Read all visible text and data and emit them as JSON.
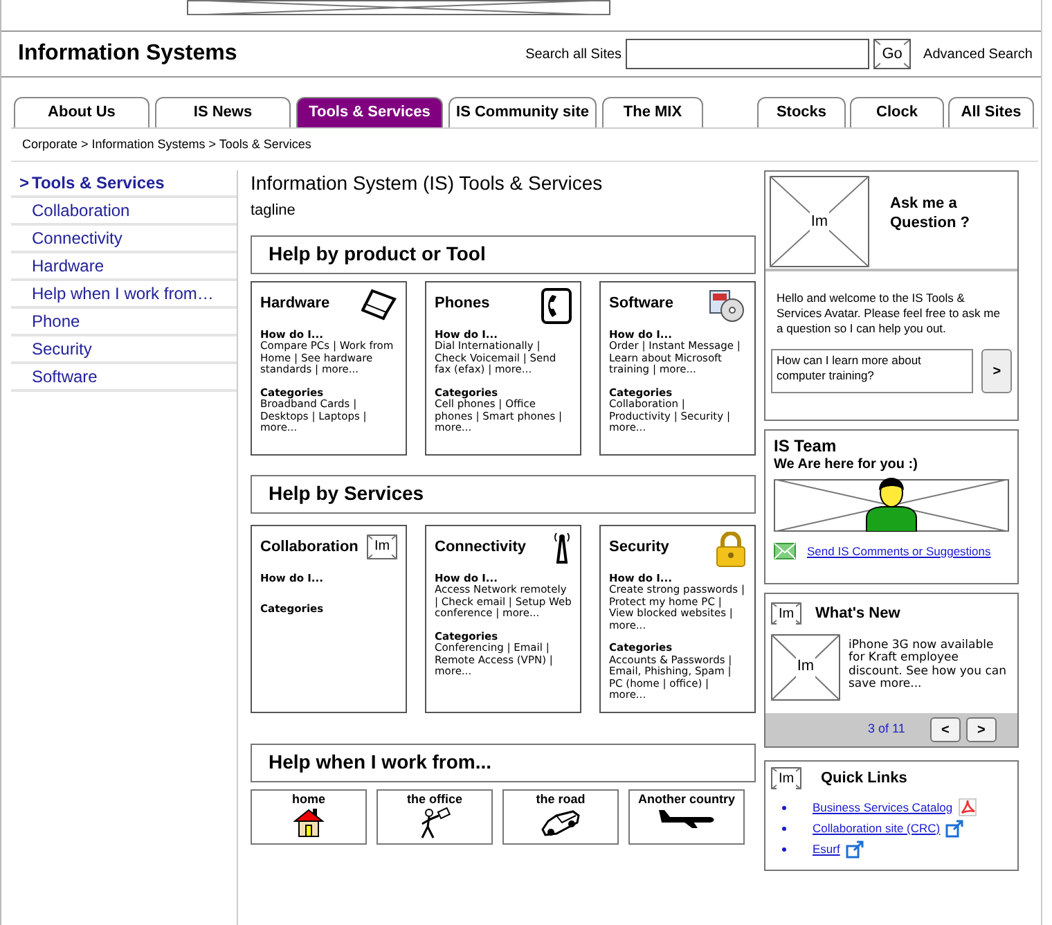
{
  "header": {
    "title": "Information Systems",
    "search_label": "Search all Sites",
    "go_button": "Go",
    "advanced_search": "Advanced Search"
  },
  "tabs_left": [
    {
      "label": "About Us",
      "selected": false
    },
    {
      "label": "IS News",
      "selected": false
    },
    {
      "label": "Tools & Services",
      "selected": true
    },
    {
      "label": "IS Community site",
      "selected": false
    },
    {
      "label": "The MIX",
      "selected": false
    }
  ],
  "tabs_right": [
    {
      "label": "Stocks",
      "selected": false
    },
    {
      "label": "Clock",
      "selected": false
    },
    {
      "label": "All Sites",
      "selected": false
    }
  ],
  "breadcrumb": "Corporate > Information Systems > Tools & Services",
  "sidebar": {
    "current_marker": ">",
    "items": [
      {
        "label": "Tools & Services",
        "selected": true
      },
      {
        "label": "Collaboration",
        "selected": false
      },
      {
        "label": "Connectivity",
        "selected": false
      },
      {
        "label": "Hardware",
        "selected": false
      },
      {
        "label": "Help when I work from…",
        "selected": false
      },
      {
        "label": "Phone",
        "selected": false
      },
      {
        "label": "Security",
        "selected": false
      },
      {
        "label": "Software",
        "selected": false
      }
    ]
  },
  "main": {
    "title": "Information System (IS) Tools & Services",
    "tagline": "tagline",
    "sections": [
      {
        "heading": "Help by product or Tool",
        "cards": [
          {
            "title": "Hardware",
            "how_heading": "How do I...",
            "how_text": "Compare PCs | Work from Home | See hardware standards | more...",
            "categories_heading": "Categories",
            "categories_text": "Broadband Cards | Desktops | Laptops | more..."
          },
          {
            "title": "Phones",
            "how_heading": "How do I...",
            "how_text": "Dial Internationally | Check Voicemail | Send fax (efax) | more...",
            "categories_heading": "Categories",
            "categories_text": "Cell phones | Office phones | Smart phones | more..."
          },
          {
            "title": "Software",
            "how_heading": "How do I...",
            "how_text": "Order | Instant Message | Learn about Microsoft training | more...",
            "categories_heading": "Categories",
            "categories_text": "Collaboration | Productivity | Security | more..."
          }
        ]
      },
      {
        "heading": "Help by Services",
        "cards": [
          {
            "title": "Collaboration",
            "placeholder": "Im",
            "how_heading": "How do I...",
            "categories_heading": "Categories"
          },
          {
            "title": "Connectivity",
            "how_heading": "How do I...",
            "how_text": "Access Network remotely | Check email | Setup Web conference | more...",
            "categories_heading": "Categories",
            "categories_text": "Conferencing | Email | Remote Access (VPN) | more..."
          },
          {
            "title": "Security",
            "how_heading": "How do I...",
            "how_text": "Create strong passwords | Protect my home PC | View blocked websites | more...",
            "categories_heading": "Categories",
            "categories_text": "Accounts & Passwords | Email, Phishing, Spam | PC (home | office) | more..."
          }
        ]
      }
    ],
    "work_from": {
      "heading": "Help when I work from...",
      "tiles": [
        "home",
        "the office",
        "the road",
        "Another country"
      ]
    }
  },
  "ask": {
    "placeholder": "Im",
    "title": "Ask me a Question ?",
    "welcome": "Hello and welcome to the IS Tools & Services Avatar. Please feel free to ask me a question so I can help you out.",
    "question_value": "How can I learn more about computer training?",
    "submit": ">"
  },
  "team": {
    "title": "IS Team",
    "subtitle": "We Are here for you :)",
    "link": "Send IS Comments or Suggestions"
  },
  "whats_new": {
    "icon_text": "Im",
    "title": "What's New",
    "image_text": "Im",
    "text": "iPhone 3G now available for Kraft employee discount. See how you can save more...",
    "pager": "3 of 11",
    "prev": "<",
    "next": ">"
  },
  "quick_links": {
    "icon_text": "Im",
    "title": "Quick Links",
    "links": [
      {
        "label": "Business Services Catalog",
        "kind": "pdf"
      },
      {
        "label": "Collaboration site (CRC)",
        "kind": "external"
      },
      {
        "label": "Esurf",
        "kind": "external"
      }
    ]
  }
}
